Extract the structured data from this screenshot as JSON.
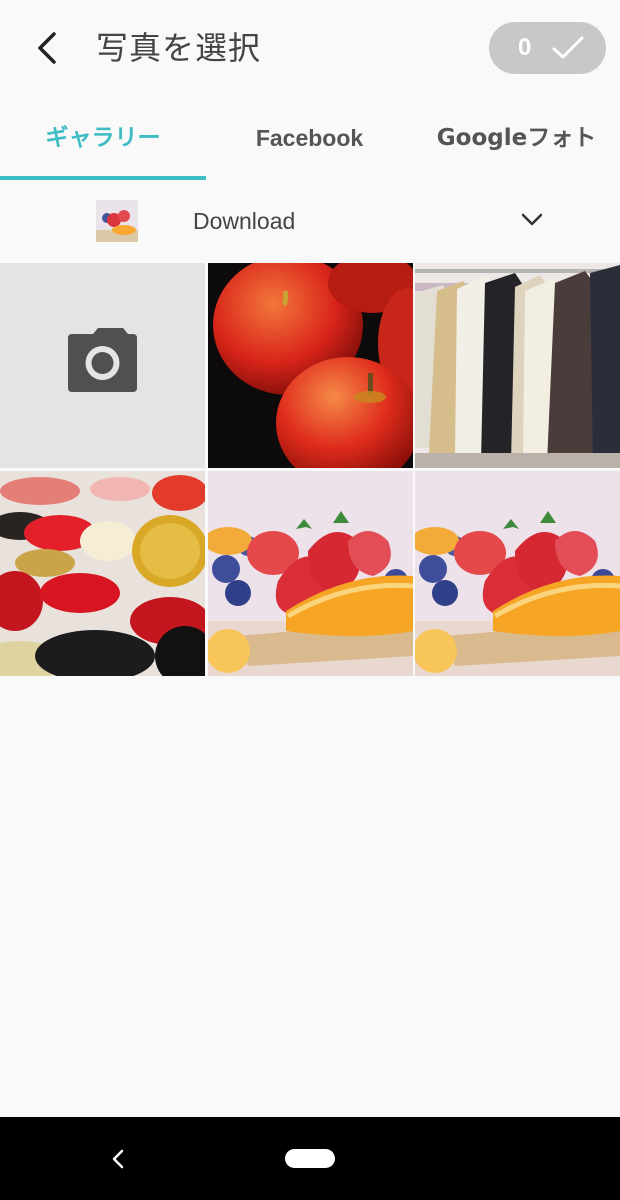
{
  "header": {
    "title": "写真を選択",
    "selected_count": "0"
  },
  "tabs": [
    {
      "label": "ギャラリー",
      "active": true
    },
    {
      "label": "Facebook",
      "active": false
    },
    {
      "label": "Googleフォト",
      "active": false
    }
  ],
  "album": {
    "name": "Download"
  },
  "grid": [
    {
      "kind": "camera",
      "icon": "camera-icon"
    },
    {
      "kind": "photo",
      "subject": "apples"
    },
    {
      "kind": "photo",
      "subject": "coats"
    },
    {
      "kind": "photo",
      "subject": "buttons"
    },
    {
      "kind": "photo",
      "subject": "strawberries"
    },
    {
      "kind": "photo",
      "subject": "strawberries"
    }
  ],
  "colors": {
    "accent": "#3dbcc4",
    "pill": "#c8c8c8",
    "background": "#f9f9f9",
    "navbar": "#000000"
  }
}
